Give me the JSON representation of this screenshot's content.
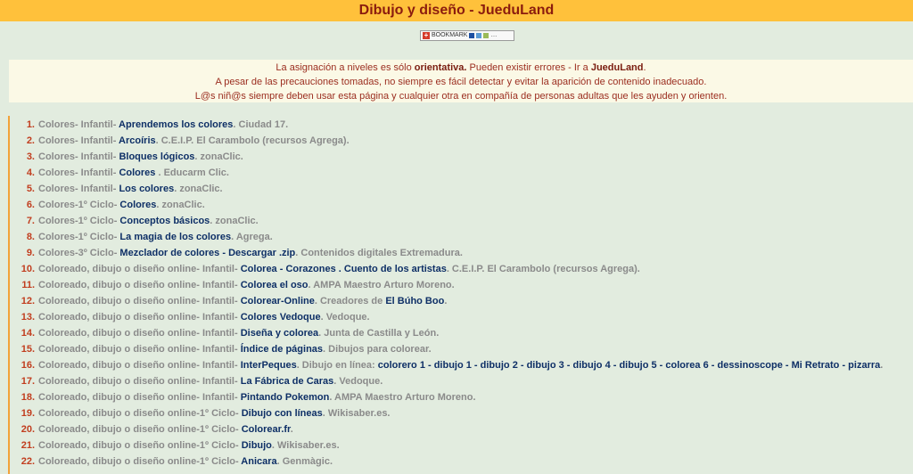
{
  "header": {
    "title": "Dibujo y diseño - JueduLand"
  },
  "bookmark": {
    "label": "BOOKMARK"
  },
  "notice": {
    "l1_a": "La asignación a niveles es sólo ",
    "l1_b": "orientativa.",
    "l1_c": " Pueden existir errores -  Ir a ",
    "l1_d": "JueduLand",
    "l1_e": ".",
    "l2": "A pesar de las precauciones tomadas, no siempre es fácil detectar y evitar la aparición de contenido inadecuado.",
    "l3": "L@s niñ@s siempre deben usar esta página y cualquier otra en compañía de personas adultas que les ayuden y orienten."
  },
  "items": [
    {
      "n": "1.",
      "cat": "Colores- Infantil- ",
      "t": "Aprendemos los colores",
      "src": ". Ciudad 17."
    },
    {
      "n": "2.",
      "cat": "Colores- Infantil- ",
      "t": "Arcoíris",
      "src": ". C.E.I.P. El Carambolo (recursos Agrega)."
    },
    {
      "n": "3.",
      "cat": "Colores- Infantil- ",
      "t": "Bloques lógicos",
      "src": ". zonaClic."
    },
    {
      "n": "4.",
      "cat": "Colores- Infantil- ",
      "t": "Colores",
      "src": " . Educarm Clic."
    },
    {
      "n": "5.",
      "cat": "Colores- Infantil- ",
      "t": "Los colores",
      "src": ". zonaClic."
    },
    {
      "n": "6.",
      "cat": "Colores-1º Ciclo- ",
      "t": "Colores",
      "src": ". zonaClic."
    },
    {
      "n": "7.",
      "cat": "Colores-1º Ciclo- ",
      "t": "Conceptos básicos",
      "src": ". zonaClic."
    },
    {
      "n": "8.",
      "cat": "Colores-1º Ciclo- ",
      "t": "La magia de los colores",
      "src": ". Agrega."
    },
    {
      "n": "9.",
      "cat": "Colores-3º Ciclo- ",
      "t": "Mezclador de colores",
      "mid": " - ",
      "t2": "Descargar .zip",
      "src": ". Contenidos digitales Extremadura."
    },
    {
      "n": "10.",
      "cat": "Coloreado, dibujo o diseño online- Infantil- ",
      "t": "Colorea",
      "mid": " - ",
      "t2": "Corazones",
      "mid2": " . ",
      "t3": "Cuento de los artistas",
      "src": ". C.E.I.P. El Carambolo (recursos Agrega)."
    },
    {
      "n": "11.",
      "cat": "Coloreado, dibujo o diseño online- Infantil- ",
      "t": "Colorea el oso",
      "src": ". AMPA Maestro Arturo Moreno."
    },
    {
      "n": "12.",
      "cat": "Coloreado, dibujo o diseño online- Infantil- ",
      "t": "Colorear-Online",
      "src": ". Creadores de ",
      "t4": "El Búho Boo",
      "src2": "."
    },
    {
      "n": "13.",
      "cat": "Coloreado, dibujo o diseño online- Infantil- ",
      "t": "Colores Vedoque",
      "src": ". Vedoque."
    },
    {
      "n": "14.",
      "cat": "Coloreado, dibujo o diseño online- Infantil- ",
      "t": "Diseña y colorea",
      "src": ". Junta de Castilla y León."
    },
    {
      "n": "15.",
      "cat": "Coloreado, dibujo o diseño online- Infantil- ",
      "t": "Índice de páginas",
      "src": ". Dibujos para colorear."
    },
    {
      "n": "16.",
      "cat": "Coloreado, dibujo o diseño online- Infantil- ",
      "t": "InterPeques",
      "src": ". Dibujo en línea: ",
      "links16": "colorero 1 - dibujo 1 - dibujo 2 - dibujo 3 - dibujo 4 - dibujo 5 - colorea 6 - dessinoscope - Mi Retrato - pizarra",
      "src2": "."
    },
    {
      "n": "17.",
      "cat": "Coloreado, dibujo o diseño online- Infantil- ",
      "t": "La Fábrica de Caras",
      "src": ". Vedoque."
    },
    {
      "n": "18.",
      "cat": "Coloreado, dibujo o diseño online- Infantil- ",
      "t": "Pintando Pokemon",
      "src": ". AMPA Maestro Arturo Moreno."
    },
    {
      "n": "19.",
      "cat": "Coloreado, dibujo o diseño online-1º Ciclo- ",
      "t": "Dibujo con líneas",
      "src": ". Wikisaber.es."
    },
    {
      "n": "20.",
      "cat": "Coloreado, dibujo o diseño online-1º Ciclo- ",
      "t": "Colorear.fr",
      "src": "."
    },
    {
      "n": "21.",
      "cat": "Coloreado, dibujo o diseño online-1º Ciclo- ",
      "t": "Dibujo",
      "src": ". Wikisaber.es."
    },
    {
      "n": "22.",
      "cat": "Coloreado, dibujo o diseño online-1º Ciclo- ",
      "t": "Anicara",
      "src": ". Genmàgic."
    }
  ]
}
